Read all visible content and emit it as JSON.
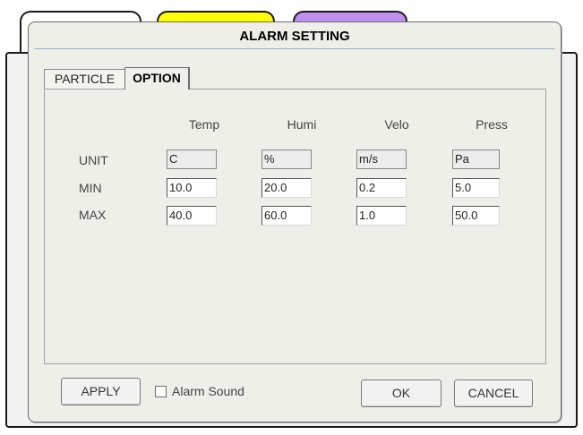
{
  "dialog": {
    "title": "ALARM SETTING"
  },
  "tabs": [
    {
      "label": "PARTICLE",
      "active": false
    },
    {
      "label": "OPTION",
      "active": true
    }
  ],
  "columns": [
    "Temp",
    "Humi",
    "Velo",
    "Press"
  ],
  "rows": [
    {
      "label": "UNIT",
      "values": [
        "C",
        "%",
        "m/s",
        "Pa"
      ],
      "readonly": true
    },
    {
      "label": "MIN",
      "values": [
        "10.0",
        "20.0",
        "0.2",
        "5.0"
      ],
      "readonly": false
    },
    {
      "label": "MAX",
      "values": [
        "40.0",
        "60.0",
        "1.0",
        "50.0"
      ],
      "readonly": false
    }
  ],
  "footer": {
    "apply_label": "APPLY",
    "alarm_sound_label": "Alarm Sound",
    "alarm_sound_checked": false,
    "ok_label": "OK",
    "cancel_label": "CANCEL"
  },
  "colors": {
    "background_tabs": [
      "#ffffff",
      "#ffff00",
      "#c08ff0"
    ],
    "dialog_bg": "#efefe9"
  }
}
